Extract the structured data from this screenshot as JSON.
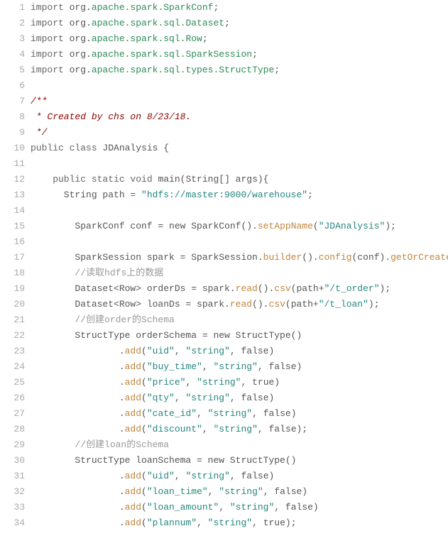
{
  "code": {
    "lines": [
      {
        "n": 1,
        "segs": [
          {
            "t": "import ",
            "c": "kw"
          },
          {
            "t": "org",
            "c": "sym"
          },
          {
            "t": ".",
            "c": "sym"
          },
          {
            "t": "apache.spark.SparkConf",
            "c": "pkg"
          },
          {
            "t": ";",
            "c": "sym"
          }
        ]
      },
      {
        "n": 2,
        "segs": [
          {
            "t": "import ",
            "c": "kw"
          },
          {
            "t": "org",
            "c": "sym"
          },
          {
            "t": ".",
            "c": "sym"
          },
          {
            "t": "apache.spark.sql.Dataset",
            "c": "pkg"
          },
          {
            "t": ";",
            "c": "sym"
          }
        ]
      },
      {
        "n": 3,
        "segs": [
          {
            "t": "import ",
            "c": "kw"
          },
          {
            "t": "org",
            "c": "sym"
          },
          {
            "t": ".",
            "c": "sym"
          },
          {
            "t": "apache.spark.sql.Row",
            "c": "pkg"
          },
          {
            "t": ";",
            "c": "sym"
          }
        ]
      },
      {
        "n": 4,
        "segs": [
          {
            "t": "import ",
            "c": "kw"
          },
          {
            "t": "org",
            "c": "sym"
          },
          {
            "t": ".",
            "c": "sym"
          },
          {
            "t": "apache.spark.sql.SparkSession",
            "c": "pkg"
          },
          {
            "t": ";",
            "c": "sym"
          }
        ]
      },
      {
        "n": 5,
        "segs": [
          {
            "t": "import ",
            "c": "kw"
          },
          {
            "t": "org",
            "c": "sym"
          },
          {
            "t": ".",
            "c": "sym"
          },
          {
            "t": "apache.spark.sql.types.StructType",
            "c": "pkg"
          },
          {
            "t": ";",
            "c": "sym"
          }
        ]
      },
      {
        "n": 6,
        "segs": [
          {
            "t": "",
            "c": "sym"
          }
        ]
      },
      {
        "n": 7,
        "segs": [
          {
            "t": "/**",
            "c": "doc"
          }
        ]
      },
      {
        "n": 8,
        "segs": [
          {
            "t": " * Created by chs on 8/23/18.",
            "c": "doc"
          }
        ]
      },
      {
        "n": 9,
        "segs": [
          {
            "t": " */",
            "c": "doc"
          }
        ]
      },
      {
        "n": 10,
        "segs": [
          {
            "t": "public class ",
            "c": "kw"
          },
          {
            "t": "JDAnalysis ",
            "c": "sym"
          },
          {
            "t": "{",
            "c": "sym"
          }
        ]
      },
      {
        "n": 11,
        "segs": [
          {
            "t": "",
            "c": "sym"
          }
        ]
      },
      {
        "n": 12,
        "segs": [
          {
            "t": "    public static void ",
            "c": "kw"
          },
          {
            "t": "main",
            "c": "sym"
          },
          {
            "t": "(String[] args){",
            "c": "sym"
          }
        ]
      },
      {
        "n": 13,
        "segs": [
          {
            "t": "      String path = ",
            "c": "sym"
          },
          {
            "t": "\"hdfs://master:9000/warehouse\"",
            "c": "str"
          },
          {
            "t": ";",
            "c": "sym"
          }
        ]
      },
      {
        "n": 14,
        "segs": [
          {
            "t": "",
            "c": "sym"
          }
        ]
      },
      {
        "n": 15,
        "segs": [
          {
            "t": "        SparkConf conf = new SparkConf().",
            "c": "sym"
          },
          {
            "t": "setAppName",
            "c": "mth"
          },
          {
            "t": "(",
            "c": "sym"
          },
          {
            "t": "\"JDAnalysis\"",
            "c": "str"
          },
          {
            "t": ");",
            "c": "sym"
          }
        ]
      },
      {
        "n": 16,
        "segs": [
          {
            "t": "",
            "c": "sym"
          }
        ]
      },
      {
        "n": 17,
        "segs": [
          {
            "t": "        SparkSession spark = SparkSession.",
            "c": "sym"
          },
          {
            "t": "builder",
            "c": "mth"
          },
          {
            "t": "().",
            "c": "sym"
          },
          {
            "t": "config",
            "c": "mth"
          },
          {
            "t": "(conf).",
            "c": "sym"
          },
          {
            "t": "getOrCreate",
            "c": "mth"
          },
          {
            "t": "();",
            "c": "sym"
          }
        ]
      },
      {
        "n": 18,
        "segs": [
          {
            "t": "        ",
            "c": "sym"
          },
          {
            "t": "//读取hdfs上的数据",
            "c": "cmt"
          }
        ]
      },
      {
        "n": 19,
        "segs": [
          {
            "t": "        Dataset<Row> orderDs = spark.",
            "c": "sym"
          },
          {
            "t": "read",
            "c": "mth"
          },
          {
            "t": "().",
            "c": "sym"
          },
          {
            "t": "csv",
            "c": "mth"
          },
          {
            "t": "(path+",
            "c": "sym"
          },
          {
            "t": "\"/t_order\"",
            "c": "str"
          },
          {
            "t": ");",
            "c": "sym"
          }
        ]
      },
      {
        "n": 20,
        "segs": [
          {
            "t": "        Dataset<Row> loanDs = spark.",
            "c": "sym"
          },
          {
            "t": "read",
            "c": "mth"
          },
          {
            "t": "().",
            "c": "sym"
          },
          {
            "t": "csv",
            "c": "mth"
          },
          {
            "t": "(path+",
            "c": "sym"
          },
          {
            "t": "\"/t_loan\"",
            "c": "str"
          },
          {
            "t": ");",
            "c": "sym"
          }
        ]
      },
      {
        "n": 21,
        "segs": [
          {
            "t": "        ",
            "c": "sym"
          },
          {
            "t": "//创建order的Schema",
            "c": "cmt"
          }
        ]
      },
      {
        "n": 22,
        "segs": [
          {
            "t": "        StructType orderSchema = new StructType()",
            "c": "sym"
          }
        ]
      },
      {
        "n": 23,
        "segs": [
          {
            "t": "                .",
            "c": "sym"
          },
          {
            "t": "add",
            "c": "mth"
          },
          {
            "t": "(",
            "c": "sym"
          },
          {
            "t": "\"uid\"",
            "c": "str"
          },
          {
            "t": ", ",
            "c": "sym"
          },
          {
            "t": "\"string\"",
            "c": "str"
          },
          {
            "t": ", false)",
            "c": "sym"
          }
        ]
      },
      {
        "n": 24,
        "segs": [
          {
            "t": "                .",
            "c": "sym"
          },
          {
            "t": "add",
            "c": "mth"
          },
          {
            "t": "(",
            "c": "sym"
          },
          {
            "t": "\"buy_time\"",
            "c": "str"
          },
          {
            "t": ", ",
            "c": "sym"
          },
          {
            "t": "\"string\"",
            "c": "str"
          },
          {
            "t": ", false)",
            "c": "sym"
          }
        ]
      },
      {
        "n": 25,
        "segs": [
          {
            "t": "                .",
            "c": "sym"
          },
          {
            "t": "add",
            "c": "mth"
          },
          {
            "t": "(",
            "c": "sym"
          },
          {
            "t": "\"price\"",
            "c": "str"
          },
          {
            "t": ", ",
            "c": "sym"
          },
          {
            "t": "\"string\"",
            "c": "str"
          },
          {
            "t": ", true)",
            "c": "sym"
          }
        ]
      },
      {
        "n": 26,
        "segs": [
          {
            "t": "                .",
            "c": "sym"
          },
          {
            "t": "add",
            "c": "mth"
          },
          {
            "t": "(",
            "c": "sym"
          },
          {
            "t": "\"qty\"",
            "c": "str"
          },
          {
            "t": ", ",
            "c": "sym"
          },
          {
            "t": "\"string\"",
            "c": "str"
          },
          {
            "t": ", false)",
            "c": "sym"
          }
        ]
      },
      {
        "n": 27,
        "segs": [
          {
            "t": "                .",
            "c": "sym"
          },
          {
            "t": "add",
            "c": "mth"
          },
          {
            "t": "(",
            "c": "sym"
          },
          {
            "t": "\"cate_id\"",
            "c": "str"
          },
          {
            "t": ", ",
            "c": "sym"
          },
          {
            "t": "\"string\"",
            "c": "str"
          },
          {
            "t": ", false)",
            "c": "sym"
          }
        ]
      },
      {
        "n": 28,
        "segs": [
          {
            "t": "                .",
            "c": "sym"
          },
          {
            "t": "add",
            "c": "mth"
          },
          {
            "t": "(",
            "c": "sym"
          },
          {
            "t": "\"discount\"",
            "c": "str"
          },
          {
            "t": ", ",
            "c": "sym"
          },
          {
            "t": "\"string\"",
            "c": "str"
          },
          {
            "t": ", false);",
            "c": "sym"
          }
        ]
      },
      {
        "n": 29,
        "segs": [
          {
            "t": "        ",
            "c": "sym"
          },
          {
            "t": "//创建loan的Schema",
            "c": "cmt"
          }
        ]
      },
      {
        "n": 30,
        "segs": [
          {
            "t": "        StructType loanSchema = new StructType()",
            "c": "sym"
          }
        ]
      },
      {
        "n": 31,
        "segs": [
          {
            "t": "                .",
            "c": "sym"
          },
          {
            "t": "add",
            "c": "mth"
          },
          {
            "t": "(",
            "c": "sym"
          },
          {
            "t": "\"uid\"",
            "c": "str"
          },
          {
            "t": ", ",
            "c": "sym"
          },
          {
            "t": "\"string\"",
            "c": "str"
          },
          {
            "t": ", false)",
            "c": "sym"
          }
        ]
      },
      {
        "n": 32,
        "segs": [
          {
            "t": "                .",
            "c": "sym"
          },
          {
            "t": "add",
            "c": "mth"
          },
          {
            "t": "(",
            "c": "sym"
          },
          {
            "t": "\"loan_time\"",
            "c": "str"
          },
          {
            "t": ", ",
            "c": "sym"
          },
          {
            "t": "\"string\"",
            "c": "str"
          },
          {
            "t": ", false)",
            "c": "sym"
          }
        ]
      },
      {
        "n": 33,
        "segs": [
          {
            "t": "                .",
            "c": "sym"
          },
          {
            "t": "add",
            "c": "mth"
          },
          {
            "t": "(",
            "c": "sym"
          },
          {
            "t": "\"loan_amount\"",
            "c": "str"
          },
          {
            "t": ", ",
            "c": "sym"
          },
          {
            "t": "\"string\"",
            "c": "str"
          },
          {
            "t": ", false)",
            "c": "sym"
          }
        ]
      },
      {
        "n": 34,
        "segs": [
          {
            "t": "                .",
            "c": "sym"
          },
          {
            "t": "add",
            "c": "mth"
          },
          {
            "t": "(",
            "c": "sym"
          },
          {
            "t": "\"plannum\"",
            "c": "str"
          },
          {
            "t": ", ",
            "c": "sym"
          },
          {
            "t": "\"string\"",
            "c": "str"
          },
          {
            "t": ", true);",
            "c": "sym"
          }
        ]
      }
    ]
  }
}
